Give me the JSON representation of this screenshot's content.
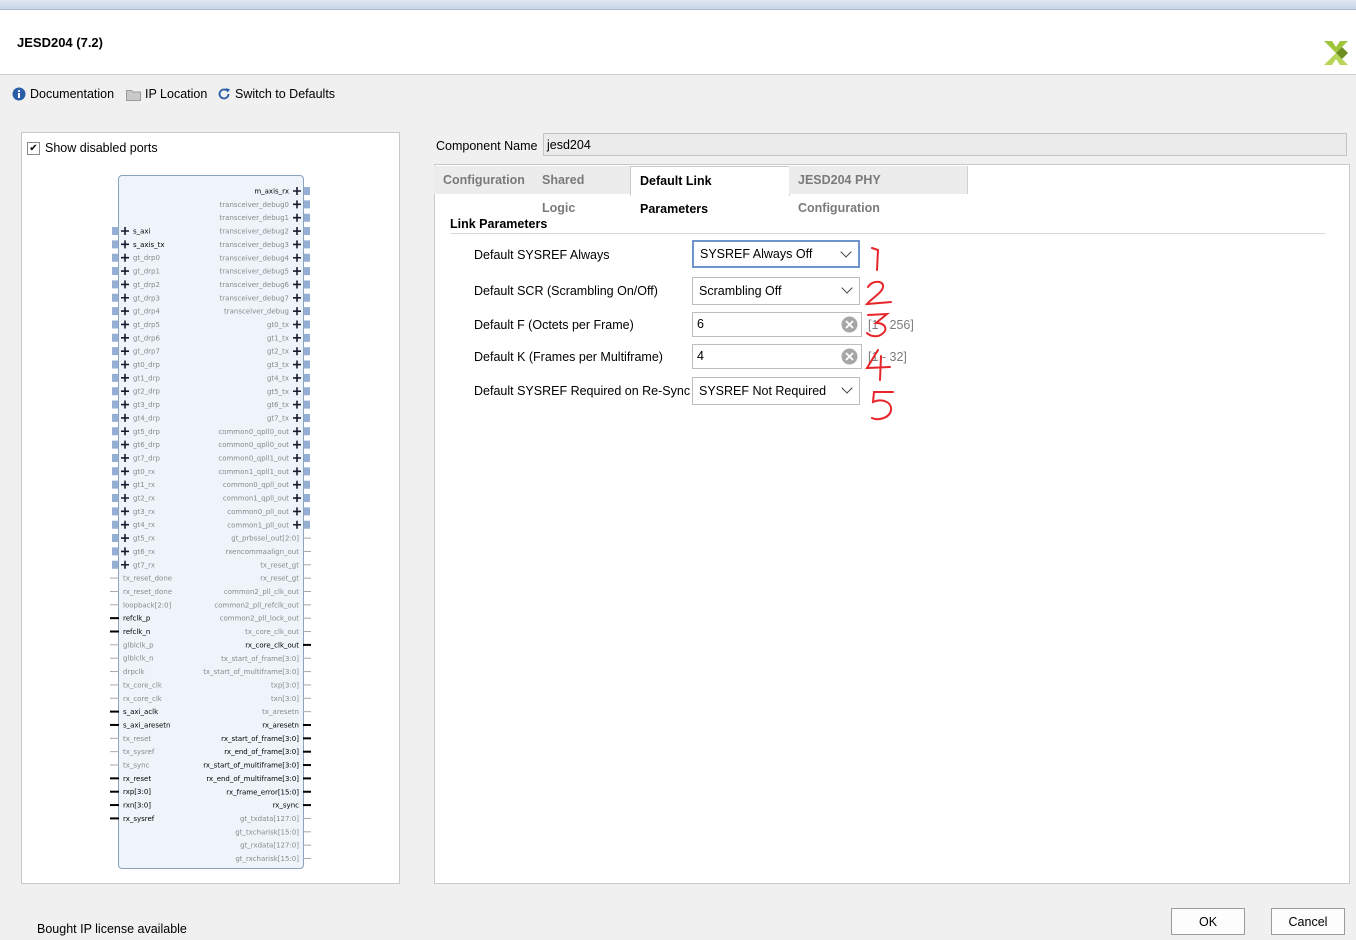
{
  "window": {
    "title": "JESD204 (7.2)"
  },
  "toolbar": {
    "documentation": "Documentation",
    "ip_location": "IP Location",
    "switch_defaults": "Switch to Defaults"
  },
  "left": {
    "show_disabled_ports": "Show disabled ports",
    "left_ports": [
      "s_axi",
      "s_axis_tx",
      "gt_drp0",
      "gt_drp1",
      "gt_drp2",
      "gt_drp3",
      "gt_drp4",
      "gt_drp5",
      "gt_drp6",
      "gt_drp7",
      "gt0_drp",
      "gt1_drp",
      "gt2_drp",
      "gt3_drp",
      "gt4_drp",
      "gt5_drp",
      "gt6_drp",
      "gt7_drp",
      "gt0_rx",
      "gt1_rx",
      "gt2_rx",
      "gt3_rx",
      "gt4_rx",
      "gt5_rx",
      "gt6_rx",
      "gt7_rx",
      "tx_reset_done",
      "rx_reset_done",
      "loopback[2:0]",
      "refclk_p",
      "refclk_n",
      "glblclk_p",
      "glblclk_n",
      "drpclk",
      "tx_core_clk",
      "rx_core_clk",
      "s_axi_aclk",
      "s_axi_aresetn",
      "tx_reset",
      "tx_sysref",
      "tx_sync",
      "rx_reset",
      "rxp[3:0]",
      "rxn[3:0]",
      "rx_sysref"
    ],
    "right_ports": [
      "m_axis_rx",
      "transceiver_debug0",
      "transceiver_debug1",
      "transceiver_debug2",
      "transceiver_debug3",
      "transceiver_debug4",
      "transceiver_debug5",
      "transceiver_debug6",
      "transceiver_debug7",
      "transceiver_debug",
      "gt0_tx",
      "gt1_tx",
      "gt2_tx",
      "gt3_tx",
      "gt4_tx",
      "gt5_tx",
      "gt6_tx",
      "gt7_tx",
      "common0_qpll0_out",
      "common0_qpll0_out",
      "common0_qpll1_out",
      "common1_qpll1_out",
      "common0_qpll_out",
      "common1_qpll_out",
      "common0_pll_out",
      "common1_pll_out",
      "gt_prbssel_out[2:0]",
      "rxencommaalign_out",
      "tx_reset_gt",
      "rx_reset_gt",
      "common2_pll_clk_out",
      "common2_pll_refclk_out",
      "common2_pll_lock_out",
      "tx_core_clk_out",
      "rx_core_clk_out",
      "tx_start_of_frame[3:0]",
      "tx_start_of_multiframe[3:0]",
      "txp[3:0]",
      "txn[3:0]",
      "tx_aresetn",
      "rx_aresetn",
      "rx_start_of_frame[3:0]",
      "rx_end_of_frame[3:0]",
      "rx_start_of_multiframe[3:0]",
      "rx_end_of_multiframe[3:0]",
      "rx_frame_error[15:0]",
      "rx_sync",
      "gt_txdata[127:0]",
      "gt_txcharisk[15:0]",
      "gt_rxdata[127:0]",
      "gt_rxcharisk[15:0]"
    ]
  },
  "component": {
    "label": "Component Name",
    "value": "jesd204"
  },
  "tabs": [
    "Configuration",
    "Shared Logic",
    "Default Link Parameters",
    "JESD204 PHY Configuration"
  ],
  "section": {
    "title": "Link Parameters"
  },
  "params": [
    {
      "label": "Default SYSREF Always",
      "value": "SYSREF Always Off",
      "annotation": "1"
    },
    {
      "label": "Default SCR (Scrambling On/Off)",
      "value": "Scrambling Off",
      "annotation": "2"
    },
    {
      "label": "Default F (Octets per Frame)",
      "value": "6",
      "range": "[1 - 256]",
      "annotation": "3"
    },
    {
      "label": "Default K (Frames per Multiframe)",
      "value": "4",
      "range": "[1 - 32]",
      "annotation": "4"
    },
    {
      "label": "Default SYSREF Required on Re-Sync",
      "value": "SYSREF Not Required",
      "annotation": "5"
    }
  ],
  "status": {
    "text": "Bought IP license available"
  },
  "buttons": {
    "ok": "OK",
    "cancel": "Cancel"
  },
  "colors": {
    "annotation_red": "#e8252a",
    "focus_border": "#6f94cb",
    "block_fill": "#eef4fa"
  }
}
